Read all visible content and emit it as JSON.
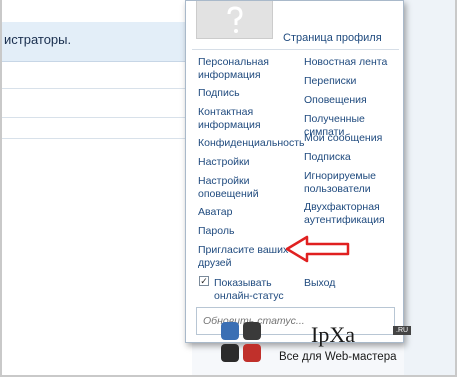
{
  "background": {
    "banner_text": "истраторы."
  },
  "menu": {
    "profile_link": "Страница профиля",
    "left_items": [
      "Персональная\nинформация",
      "Подпись",
      "Контактная\nинформация",
      "Конфиденциальность",
      "Настройки",
      "Настройки\nоповещений",
      "Аватар",
      "Пароль",
      "Пригласите ваших\nдрузей"
    ],
    "right_items": [
      "Новостная лента",
      "Переписки",
      "Оповещения",
      "Полученные симпати",
      "Мои сообщения",
      "Подписка",
      "Игнорируемые\nпользователи",
      "Двухфакторная\nаутентификация"
    ],
    "show_online_label": "Показывать\nонлайн-статус",
    "show_online_checked": true,
    "logout_label": "Выход",
    "status_placeholder": "Обновить статус..."
  },
  "watermark": {
    "logo_text": "IpXa",
    "logo_domain": ".RU",
    "tagline": "Все для Web-мастера",
    "tile_colors": [
      "#3b6fb4",
      "#3a3a3a",
      "#2b2b2b",
      "#c0302b"
    ]
  },
  "arrow_color": "#e02020"
}
